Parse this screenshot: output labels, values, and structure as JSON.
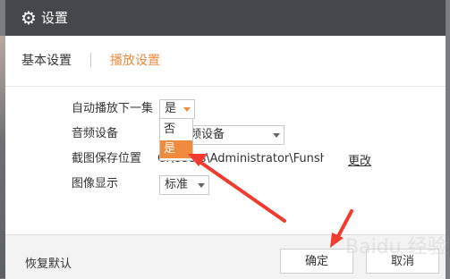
{
  "window": {
    "title": "设置"
  },
  "tabs": [
    {
      "label": "基本设置",
      "active": false
    },
    {
      "label": "播放设置",
      "active": true
    }
  ],
  "settings": {
    "autoplay_next": {
      "label": "自动播放下一集",
      "value": "是"
    },
    "audio_device": {
      "label": "音频设备",
      "value": "频设备"
    },
    "screenshot_path": {
      "label": "截图保存位置",
      "value": "C:\\Users\\Administrator\\Funshi...",
      "change_label": "更改"
    },
    "image_display": {
      "label": "图像显示",
      "value": "标准"
    }
  },
  "dropdown": {
    "options": [
      "否",
      "是"
    ],
    "highlighted": "是"
  },
  "footer": {
    "restore_label": "恢复默认",
    "ok_label": "确定",
    "cancel_label": "取消"
  },
  "colors": {
    "accent": "#f08a3c",
    "titlebar": "#44474c",
    "arrow": "#f23b2e"
  },
  "icons": {
    "title": "gear-icon"
  },
  "watermark": "Baidu 经验"
}
